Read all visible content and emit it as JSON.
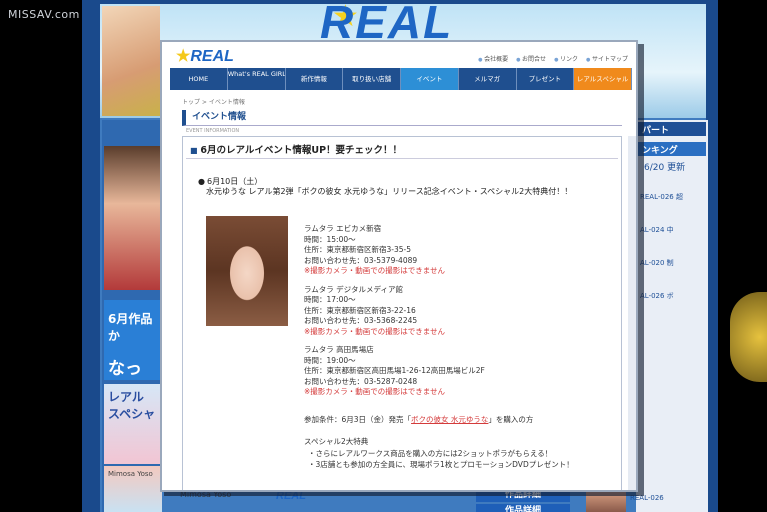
{
  "watermark": "MISSAV.com",
  "background": {
    "logo": "REAL",
    "left_blue": {
      "line1": "6月作品か",
      "line2": "なっ"
    },
    "left_pink": "レアル スペシャ",
    "left_bottom": "Mimosa Yoso",
    "right_head": "パート",
    "right_rank": "ンキング",
    "right_date": "6/20 更新",
    "right_list": [
      "REAL-026 超",
      "AL-024 中",
      "AL-020 制",
      "AL-026 ボ"
    ],
    "bottom_btn1": "作品詳細",
    "bottom_btn2": "作品詳細",
    "bottom_real": "REAL",
    "bottom_right_text": "REAL-026"
  },
  "popup": {
    "logo": "REAL",
    "header_links": [
      "会社概要",
      "お問合せ",
      "リンク",
      "サイトマップ"
    ],
    "nav": [
      {
        "label": "HOME",
        "two": false,
        "style": ""
      },
      {
        "label": "What's REAL GIRLS",
        "two": true,
        "style": ""
      },
      {
        "label": "新作情報",
        "two": false,
        "style": ""
      },
      {
        "label": "取り扱い店舗",
        "two": false,
        "style": ""
      },
      {
        "label": "イベント",
        "two": false,
        "style": "active"
      },
      {
        "label": "メルマガ",
        "two": false,
        "style": ""
      },
      {
        "label": "プレゼント",
        "two": false,
        "style": ""
      },
      {
        "label": "レアルスペシャル",
        "two": false,
        "style": "orange"
      }
    ],
    "breadcrumb": "トップ > イベント情報",
    "section_title": "イベント情報",
    "section_sub": "EVENT INFORMATION",
    "box_title": "6月のレアルイベント情報UP！要チェック！！",
    "date": "6月10日（土）",
    "desc": "水元ゆうな レアル第2弾「ボクの彼女 水元ゆうな」リリース記念イベント・スペシャル2大特典付！！",
    "shops": [
      {
        "name": "ラムタラ エビカメ新宿",
        "time": "時間：15:00〜",
        "address": "住所：東京都新宿区新宿3-35-5",
        "tel": "お問い合わせ先：03-5379-4089",
        "warn": "※撮影カメラ・動画での撮影はできません"
      },
      {
        "name": "ラムタラ デジタルメディア館",
        "time": "時間：17:00〜",
        "address": "住所：東京都新宿区新宿3-22-16",
        "tel": "お問い合わせ先：03-5368-2245",
        "warn": "※撮影カメラ・動画での撮影はできません"
      },
      {
        "name": "ラムタラ 高田馬場店",
        "time": "時間：19:00〜",
        "address": "住所：東京都新宿区高田馬場1-26-12高田馬場ビル2F",
        "tel": "お問い合わせ先：03-5287-0248",
        "warn": "※撮影カメラ・動画での撮影はできません"
      }
    ],
    "target_prefix": "参加条件：6月3日（金）発売「",
    "target_link": "ボクの彼女 水元ゆうな",
    "target_suffix": "」を購入の方",
    "special_title": "スペシャル2大特典",
    "specials": [
      "さらにレアルワークス商品を購入の方には2ショットポラがもらえる！",
      "3店舗とも参加の方全員に、現場ポラ1枚とプロモーションDVDプレゼント！"
    ]
  }
}
